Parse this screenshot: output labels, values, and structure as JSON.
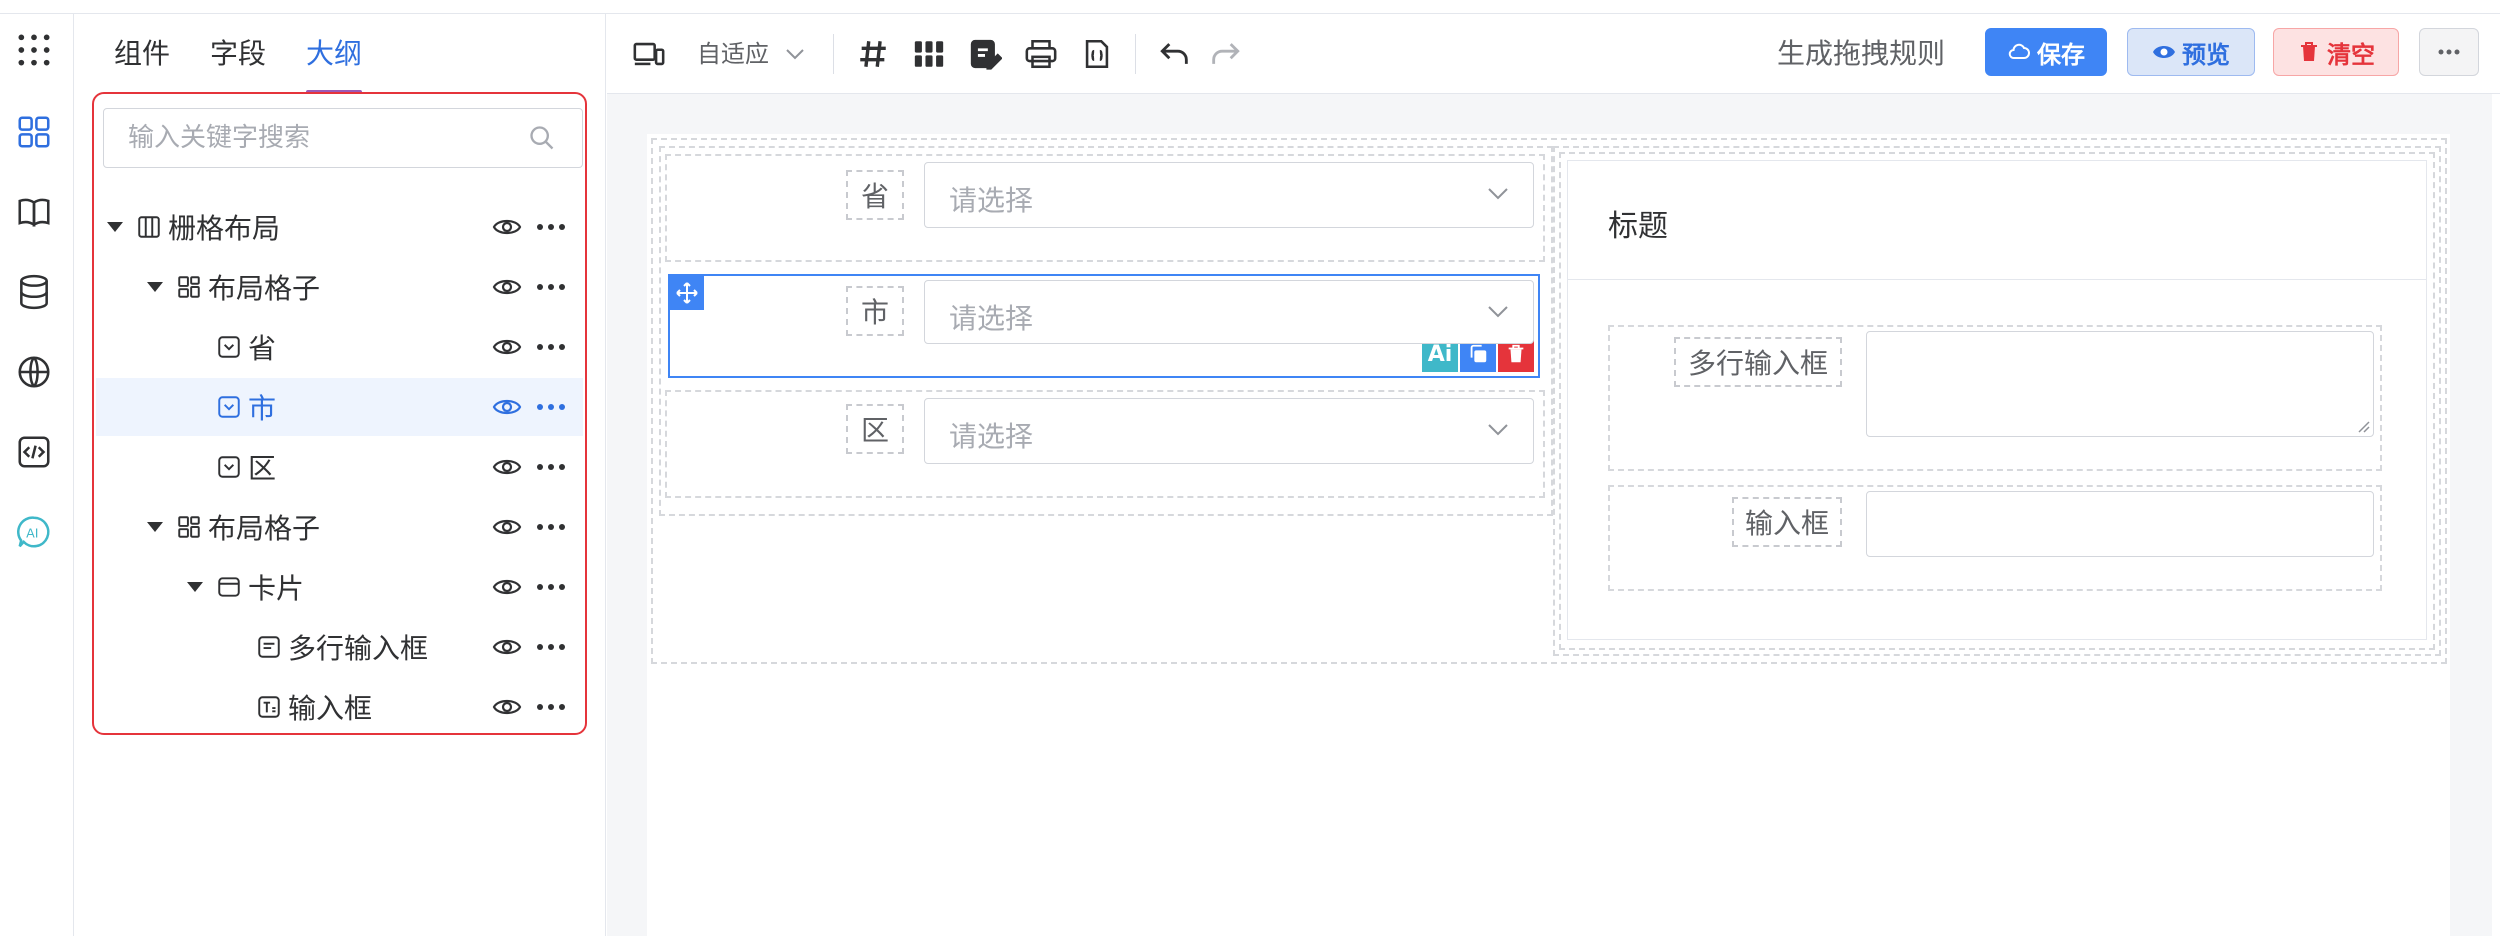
{
  "left_tabs": [
    {
      "label": "组件"
    },
    {
      "label": "字段"
    },
    {
      "label": "大纲",
      "active": true
    }
  ],
  "search": {
    "placeholder": "输入关键字搜索"
  },
  "outline": [
    {
      "label": "栅格布局",
      "icon": "grid-layout-icon",
      "expanded": true
    },
    {
      "label": "布局格子",
      "icon": "layout-cell-icon",
      "expanded": true
    },
    {
      "label": "省",
      "icon": "select-field-icon"
    },
    {
      "label": "市",
      "icon": "select-field-icon",
      "selected": true
    },
    {
      "label": "区",
      "icon": "select-field-icon"
    },
    {
      "label": "布局格子",
      "icon": "layout-cell-icon",
      "expanded": true
    },
    {
      "label": "卡片",
      "icon": "card-icon",
      "expanded": true
    },
    {
      "label": "多行输入框",
      "icon": "textarea-icon"
    },
    {
      "label": "输入框",
      "icon": "input-icon"
    }
  ],
  "toolbar": {
    "device_mode": "自适应",
    "generate_rules": "生成拖拽规则",
    "save": "保存",
    "preview": "预览",
    "clear": "清空"
  },
  "form": {
    "province": {
      "label": "省",
      "placeholder": "请选择"
    },
    "city": {
      "label": "市",
      "placeholder": "请选择"
    },
    "district": {
      "label": "区",
      "placeholder": "请选择"
    },
    "card_title": "标题",
    "textarea": {
      "label": "多行输入框"
    },
    "input": {
      "label": "输入框"
    },
    "ai_badge": "Ai"
  },
  "colors": {
    "primary": "#3f85f5",
    "danger": "#e5343b",
    "selection_bg": "#eef4fe",
    "ai_badge": "#3fb8c9"
  }
}
